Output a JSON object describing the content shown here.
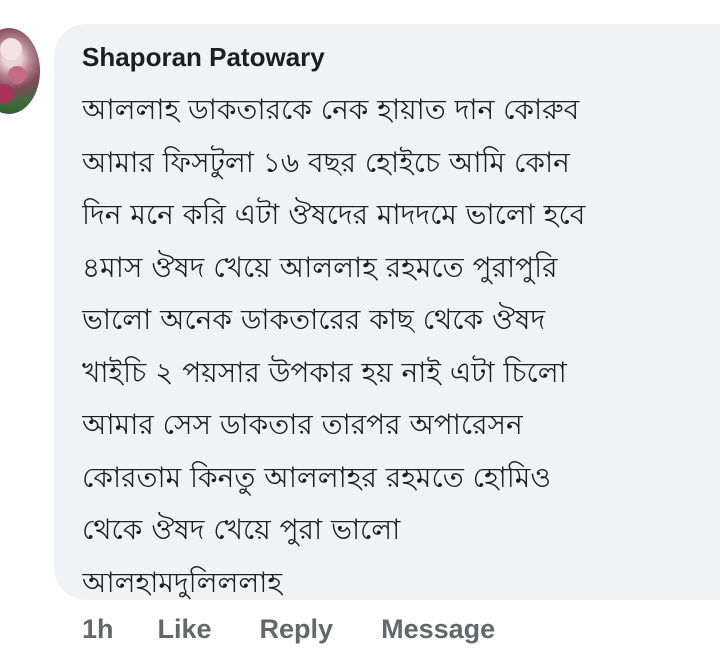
{
  "comment": {
    "author": "Shaporan Patowary",
    "lines": [
      "আললাহ ডাকতারকে নেক হায়াত দান কোরুব",
      "আমার ফিসটুলা ১৬ বছর হোইচে আমি কোন",
      "দিন মনে করি এটা ঔষদের মাদদমে ভালো হবে",
      "৪মাস ঔষদ খেয়ে আললাহ রহমতে পুরাপুরি",
      "ভালো অনেক ডাকতারের কাছ থেকে ঔষদ",
      "খাইচি ২ পয়সার উপকার হয় নাই এটা চিলো",
      "আমার সেস ডাকতার তারপর অপারেসন",
      "কোরতাম কিনতু আললাহর রহমতে হোমিও",
      "থেকে ঔষদ খেয়ে পুরা ভালো",
      "আলহামদুলিললাহ"
    ],
    "time": "1h",
    "like_label": "Like",
    "reply_label": "Reply",
    "message_label": "Message"
  },
  "colors": {
    "bubble_background": "#f0f2f5",
    "text": "#1c1e21",
    "secondary_text": "#65676b"
  }
}
